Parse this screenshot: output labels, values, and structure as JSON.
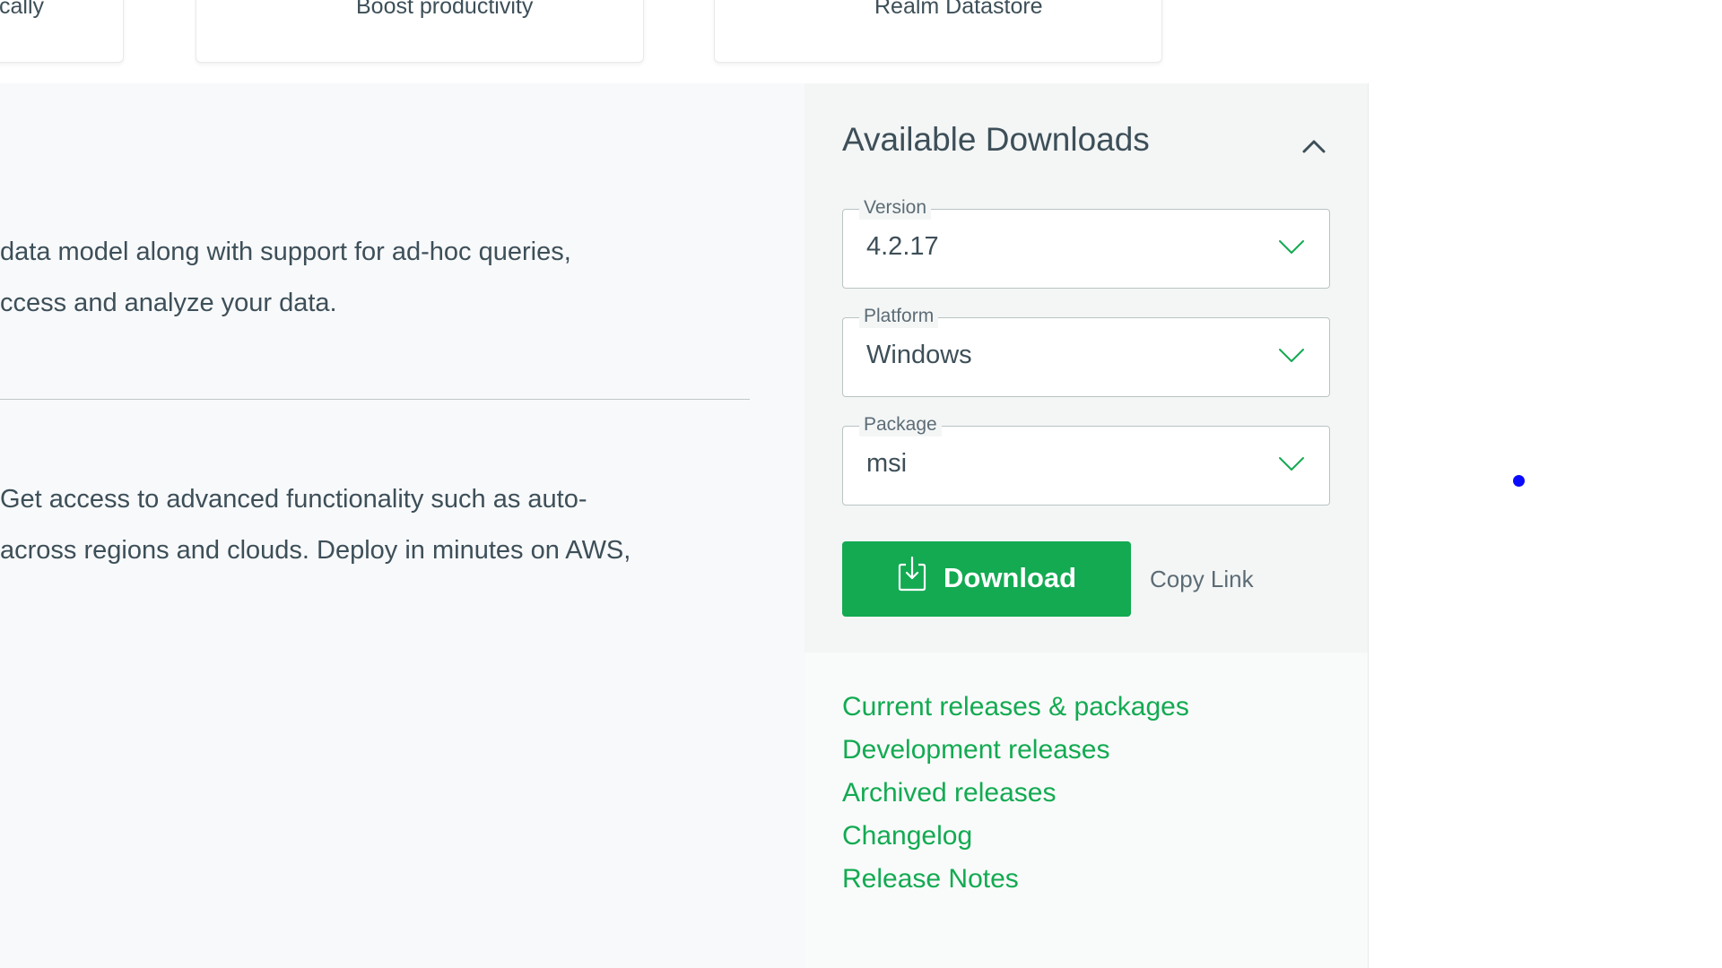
{
  "cards": [
    {
      "text": "cally"
    },
    {
      "text": "Boost productivity"
    },
    {
      "text": "Realm Datastore"
    }
  ],
  "main": {
    "paragraph_1": {
      "line_1": "data model along with support for ad-hoc queries,",
      "line_2": "ccess and analyze your data."
    },
    "paragraph_2": {
      "line_1": "Get access to advanced functionality such as auto-",
      "line_2": " across regions and clouds. Deploy in minutes on AWS,"
    }
  },
  "downloads": {
    "title": "Available Downloads",
    "version": {
      "label": "Version",
      "value": "4.2.17"
    },
    "platform": {
      "label": "Platform",
      "value": "Windows"
    },
    "package": {
      "label": "Package",
      "value": "msi"
    },
    "download_label": "Download",
    "copy_link_label": "Copy Link",
    "links": [
      "Current releases & packages",
      "Development releases",
      "Archived releases",
      "Changelog",
      "Release Notes"
    ]
  },
  "colors": {
    "accent_green": "#13aa52",
    "cursor_dot": "#0a0aff"
  },
  "icons": {
    "collapse": "chevron-up-icon",
    "dropdown": "chevron-down-icon",
    "download": "download-icon"
  }
}
